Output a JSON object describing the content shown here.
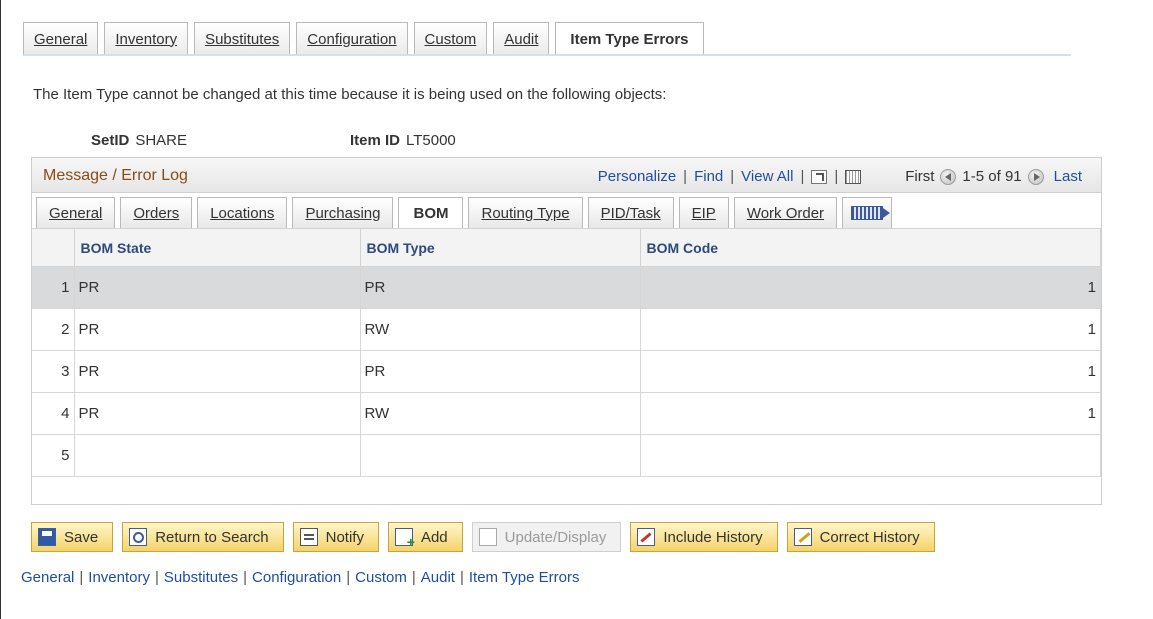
{
  "page_tabs": [
    {
      "label": "General",
      "active": false
    },
    {
      "label": "Inventory",
      "active": false
    },
    {
      "label": "Substitutes",
      "active": false
    },
    {
      "label": "Configuration",
      "active": false
    },
    {
      "label": "Custom",
      "active": false
    },
    {
      "label": "Audit",
      "active": false
    },
    {
      "label": "Item Type Errors",
      "active": true
    }
  ],
  "intro_text": "The Item Type cannot be changed at this time because it is being used on the following objects:",
  "keys": {
    "setid_label": "SetID",
    "setid_value": "SHARE",
    "itemid_label": "Item ID",
    "itemid_value": "LT5000"
  },
  "grid": {
    "title": "Message / Error Log",
    "nav": {
      "personalize": "Personalize",
      "find": "Find",
      "view_all": "View All",
      "first": "First",
      "range": "1-5 of 91",
      "last": "Last"
    },
    "tabs": [
      {
        "label": "General",
        "active": false
      },
      {
        "label": "Orders",
        "active": false
      },
      {
        "label": "Locations",
        "active": false
      },
      {
        "label": "Purchasing",
        "active": false
      },
      {
        "label": "BOM",
        "active": true
      },
      {
        "label": "Routing Type",
        "active": false
      },
      {
        "label": "PID/Task",
        "active": false
      },
      {
        "label": "EIP",
        "active": false
      },
      {
        "label": "Work Order",
        "active": false
      }
    ],
    "columns": [
      "BOM State",
      "BOM Type",
      "BOM Code"
    ],
    "rows": [
      {
        "num": "1",
        "state": "PR",
        "type": "PR",
        "code": "1"
      },
      {
        "num": "2",
        "state": "PR",
        "type": "RW",
        "code": "1"
      },
      {
        "num": "3",
        "state": "PR",
        "type": "PR",
        "code": "1"
      },
      {
        "num": "4",
        "state": "PR",
        "type": "RW",
        "code": "1"
      },
      {
        "num": "5",
        "state": "",
        "type": "",
        "code": ""
      }
    ]
  },
  "toolbar": {
    "save": "Save",
    "return_to_search": "Return to Search",
    "notify": "Notify",
    "add": "Add",
    "update_display": "Update/Display",
    "include_history": "Include History",
    "correct_history": "Correct History"
  },
  "footer_links": [
    "General",
    "Inventory",
    "Substitutes",
    "Configuration",
    "Custom",
    "Audit",
    "Item Type Errors"
  ]
}
